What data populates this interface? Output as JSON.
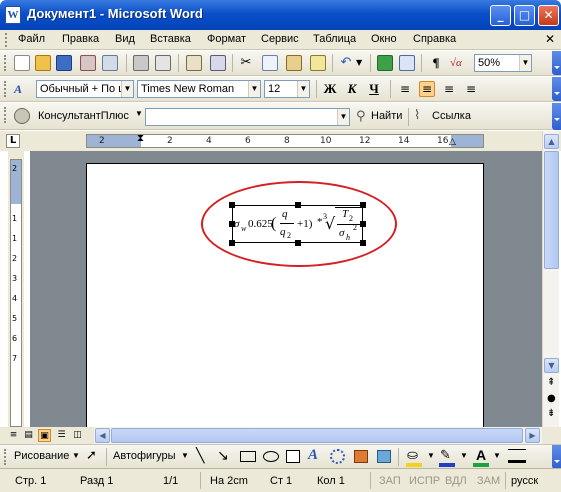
{
  "window": {
    "title": "Документ1 - Microsoft Word",
    "app_icon": "W",
    "controls": {
      "minimize": "_",
      "maximize": "□",
      "close": "✕"
    }
  },
  "menu": {
    "items": [
      "Файл",
      "Правка",
      "Вид",
      "Вставка",
      "Формат",
      "Сервис",
      "Таблица",
      "Окно",
      "Справка"
    ],
    "close_doc": "✕"
  },
  "standard_toolbar": {
    "zoom": "50%",
    "paragraph_mark": "¶",
    "formula_label": "√α"
  },
  "format_toolbar": {
    "style": "Обычный + По ц",
    "font": "Times New Roman",
    "size": "12",
    "bold": "Ж",
    "italic": "К",
    "underline": "Ч"
  },
  "consultant_toolbar": {
    "name": "КонсультантПлюс",
    "search_value": "",
    "find_label": "Найти",
    "link_label": "Ссылка"
  },
  "ruler": {
    "tab_selector": "L",
    "ticks": [
      "2",
      "2",
      "4",
      "6",
      "8",
      "10",
      "12",
      "14",
      "16"
    ],
    "vertical_ticks": [
      "2",
      "1",
      "1",
      "2",
      "3",
      "4",
      "5",
      "6",
      "7"
    ]
  },
  "formula": {
    "sigma": "σ",
    "sub_w": "w",
    "coef": "0.625",
    "q": "q",
    "q2": "q",
    "q2_sub": "2",
    "plus_one": "+1)",
    "star": "*",
    "root_index": "3",
    "T": "T",
    "T_sub": "2",
    "sigma_h": "σ",
    "sigma_h_sub": "h",
    "sigma_h_pow": "2"
  },
  "drawing_toolbar": {
    "draw_label": "Рисование",
    "autoshapes_label": "Автофигуры",
    "colors": {
      "fill": "#f2d21a",
      "line": "#1f3fc8",
      "font": "#1aa23b"
    }
  },
  "status": {
    "page": "Стр. 1",
    "section": "Разд 1",
    "pages": "1/1",
    "position": "На 2cm",
    "line": "Ст 1",
    "column": "Кол 1",
    "rec": "ЗАП",
    "trk": "ИСПР",
    "ext": "ВДЛ",
    "ovr": "ЗАМ",
    "language": "русск"
  }
}
